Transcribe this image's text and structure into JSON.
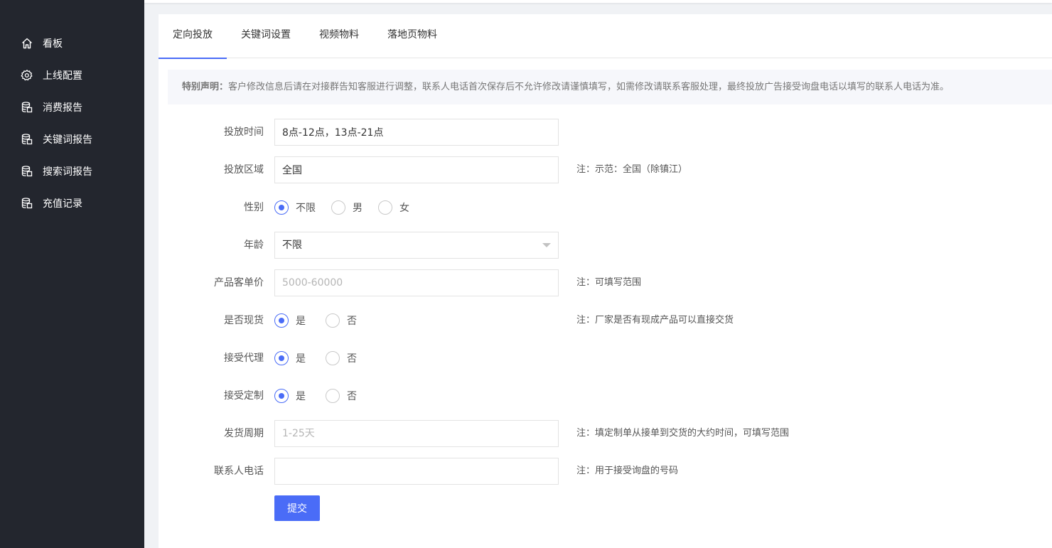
{
  "sidebar": {
    "items": [
      {
        "label": "看板",
        "icon": "home-icon"
      },
      {
        "label": "上线配置",
        "icon": "gear-icon"
      },
      {
        "label": "消费报告",
        "icon": "database-icon"
      },
      {
        "label": "关键词报告",
        "icon": "database-icon"
      },
      {
        "label": "搜索词报告",
        "icon": "database-icon"
      },
      {
        "label": "充值记录",
        "icon": "database-icon"
      }
    ]
  },
  "tabs": [
    {
      "label": "定向投放",
      "active": true
    },
    {
      "label": "关键词设置",
      "active": false
    },
    {
      "label": "视频物料",
      "active": false
    },
    {
      "label": "落地页物料",
      "active": false
    }
  ],
  "notice": {
    "title": "特别声明：",
    "text": "客户修改信息后请在对接群告知客服进行调整，联系人电话首次保存后不允许修改请谨慎填写，如需修改请联系客服处理，最终投放广告接受询盘电话以填写的联系人电话为准。"
  },
  "form": {
    "time": {
      "label": "投放时间",
      "value": "8点-12点，13点-21点"
    },
    "region": {
      "label": "投放区域",
      "value": "全国",
      "note": "注：示范：全国（除镇江）"
    },
    "gender": {
      "label": "性别",
      "options": [
        "不限",
        "男",
        "女"
      ],
      "selected": "不限"
    },
    "age": {
      "label": "年龄",
      "value": "不限"
    },
    "price": {
      "label": "产品客单价",
      "placeholder": "5000-60000",
      "note": "注：可填写范围"
    },
    "in_stock": {
      "label": "是否现货",
      "options": [
        "是",
        "否"
      ],
      "selected": "是",
      "note": "注：厂家是否有现成产品可以直接交货"
    },
    "agency": {
      "label": "接受代理",
      "options": [
        "是",
        "否"
      ],
      "selected": "是"
    },
    "custom": {
      "label": "接受定制",
      "options": [
        "是",
        "否"
      ],
      "selected": "是"
    },
    "delivery": {
      "label": "发货周期",
      "placeholder": "1-25天",
      "note": "注：填定制单从接单到交货的大约时间，可填写范围"
    },
    "phone": {
      "label": "联系人电话",
      "value": "",
      "note": "注：用于接受询盘的号码"
    },
    "submit_label": "提交"
  },
  "colors": {
    "accent": "#4a6cf7",
    "sidebar_bg": "#23262e"
  }
}
